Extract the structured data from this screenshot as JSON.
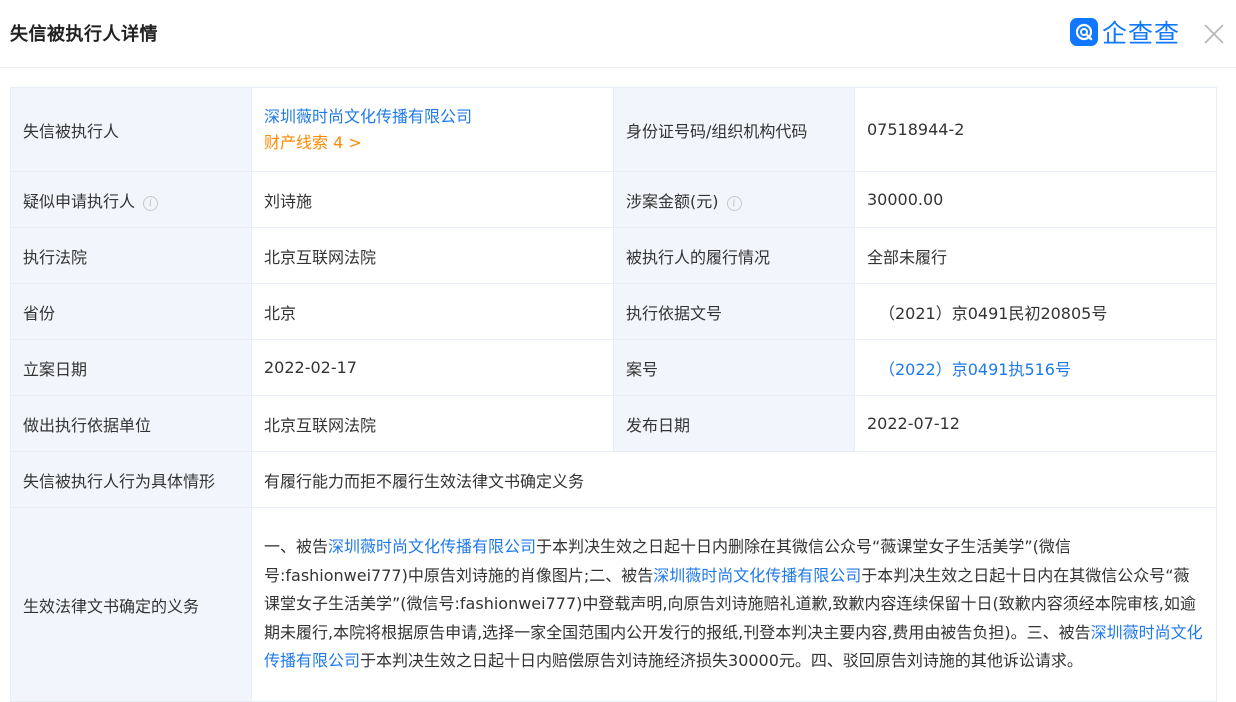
{
  "header": {
    "title": "失信被执行人详情",
    "brand_name": "企查查",
    "logo_icon": "qichacha-logo-icon",
    "close_icon": "close-icon",
    "brand_color": "#1277ff"
  },
  "rows": {
    "executee": {
      "label": "失信被执行人",
      "company": "深圳薇时尚文化传播有限公司",
      "asset_clue": "财产线索 4 >",
      "id_label": "身份证号码/组织机构代码",
      "id_value": "07518944-2"
    },
    "applicant": {
      "label": "疑似申请执行人",
      "value": "刘诗施",
      "amount_label": "涉案金额(元)",
      "amount_value": "30000.00"
    },
    "court": {
      "label": "执行法院",
      "value": "北京互联网法院",
      "status_label": "被执行人的履行情况",
      "status_value": "全部未履行"
    },
    "province": {
      "label": "省份",
      "value": "北京",
      "basis_label": "执行依据文号",
      "basis_value": "（2021）京0491民初20805号"
    },
    "filing": {
      "label": "立案日期",
      "value": "2022-02-17",
      "case_label": "案号",
      "case_value": "（2022）京0491执516号"
    },
    "issuer": {
      "label": "做出执行依据单位",
      "value": "北京互联网法院",
      "publish_label": "发布日期",
      "publish_value": "2022-07-12"
    },
    "behavior": {
      "label": "失信被执行人行为具体情形",
      "value": "有履行能力而拒不履行生效法律文书确定义务"
    },
    "duty": {
      "label": "生效法律文书确定的义务",
      "p1": "一、被告",
      "c1": "深圳薇时尚文化传播有限公司",
      "p2": "于本判决生效之日起十日内删除在其微信公众号“薇课堂女子生活美学”(微信号:fashionwei777)中原告刘诗施的肖像图片;二、被告",
      "c2": "深圳薇时尚文化传播有限公司",
      "p3": "于本判决生效之日起十日内在其微信公众号“薇课堂女子生活美学”(微信号:fashionwei777)中登载声明,向原告刘诗施赔礼道歉,致歉内容连续保留十日(致歉内容须经本院审核,如逾期未履行,本院将根据原告申请,选择一家全国范围内公开发行的报纸,刊登本判决主要内容,费用由被告负担)。三、被告",
      "c3": "深圳薇时尚文化传播有限公司",
      "p4": "于本判决生效之日起十日内赔偿原告刘诗施经济损失30000元。四、驳回原告刘诗施的其他诉讼请求。"
    }
  },
  "colors": {
    "link": "#1f7ae8",
    "asset_clue": "#ff8a00",
    "label_bg": "#f2f6fc",
    "border": "#e8eef5"
  }
}
